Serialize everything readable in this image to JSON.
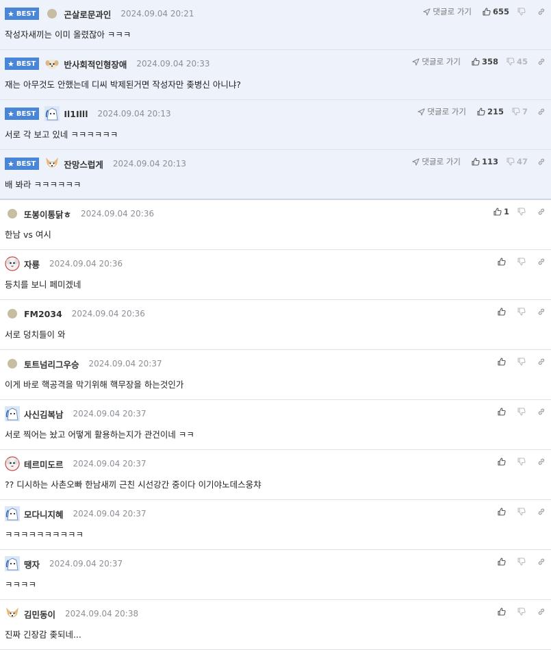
{
  "best_label": "BEST",
  "goto_label": "댓글로 가기",
  "colors": {
    "best_badge": "#4a86d8",
    "best_row_bg": "#eef3fb",
    "text": "#333333",
    "muted": "#8a8f96"
  },
  "comments": [
    {
      "best": true,
      "avatar": "dot-avatar",
      "nick": "곤살로문과인",
      "date": "2024.09.04 20:21",
      "text": "작성자새끼는 이미 올렸잖아 ㅋㅋㅋ",
      "up": "655",
      "down": ""
    },
    {
      "best": true,
      "avatar": "puppy-avatar",
      "nick": "반사회적인형장애",
      "date": "2024.09.04 20:33",
      "text": "재는 아무것도 안했는데 디씨 박제된거면 작성자만 좆병신 아니냐?",
      "up": "358",
      "down": "45"
    },
    {
      "best": true,
      "avatar": "blue-avatar",
      "nick": "Il1Illl",
      "date": "2024.09.04 20:13",
      "text": "서로 각 보고 있네 ㅋㅋㅋㅋㅋㅋ",
      "up": "215",
      "down": "7"
    },
    {
      "best": true,
      "avatar": "fox-avatar",
      "nick": "잔망스럽게",
      "date": "2024.09.04 20:13",
      "text": "배 봐라 ㅋㅋㅋㅋㅋㅋ",
      "up": "113",
      "down": "47"
    },
    {
      "best": false,
      "avatar": "dot-avatar",
      "nick": "또봉이통닭ㅎ",
      "date": "2024.09.04 20:36",
      "text": "한남 vs 여시",
      "up": "1",
      "down": ""
    },
    {
      "best": false,
      "avatar": "dog-avatar",
      "nick": "자룡",
      "date": "2024.09.04 20:36",
      "text": "등치를 보니 페미겠네",
      "up": "",
      "down": ""
    },
    {
      "best": false,
      "avatar": "dot-avatar",
      "nick": "FM2034",
      "date": "2024.09.04 20:36",
      "text": "서로 덩치들이 와",
      "up": "",
      "down": ""
    },
    {
      "best": false,
      "avatar": "dot-avatar",
      "nick": "토트넘리그우승",
      "date": "2024.09.04 20:37",
      "text": "이게 바로 핵공격을 막기위해 핵무장을 하는것인가",
      "up": "",
      "down": ""
    },
    {
      "best": false,
      "avatar": "blue-avatar",
      "nick": "사신김복남",
      "date": "2024.09.04 20:37",
      "text": "서로 찍어는 놨고 어떻게 활용하는지가 관건이네 ㅋㅋ",
      "up": "",
      "down": ""
    },
    {
      "best": false,
      "avatar": "dog-avatar",
      "nick": "테르미도르",
      "date": "2024.09.04 20:37",
      "text": "?? 디시하는 사촌오빠 한남새끼 근친 시선강간 중이다 이기야노데스웅챠",
      "up": "",
      "down": ""
    },
    {
      "best": false,
      "avatar": "blue-avatar",
      "nick": "모다니지혜",
      "date": "2024.09.04 20:37",
      "text": "ㅋㅋㅋㅋㅋㅋㅋㅋㅋㅋ",
      "up": "",
      "down": ""
    },
    {
      "best": false,
      "avatar": "blue-avatar",
      "nick": "땡자",
      "date": "2024.09.04 20:37",
      "text": "ㅋㅋㅋㅋ",
      "up": "",
      "down": ""
    },
    {
      "best": false,
      "avatar": "fox-avatar",
      "nick": "김민동이",
      "date": "2024.09.04 20:38",
      "text": "진짜 긴장감 좆되네...",
      "up": "",
      "down": ""
    }
  ]
}
